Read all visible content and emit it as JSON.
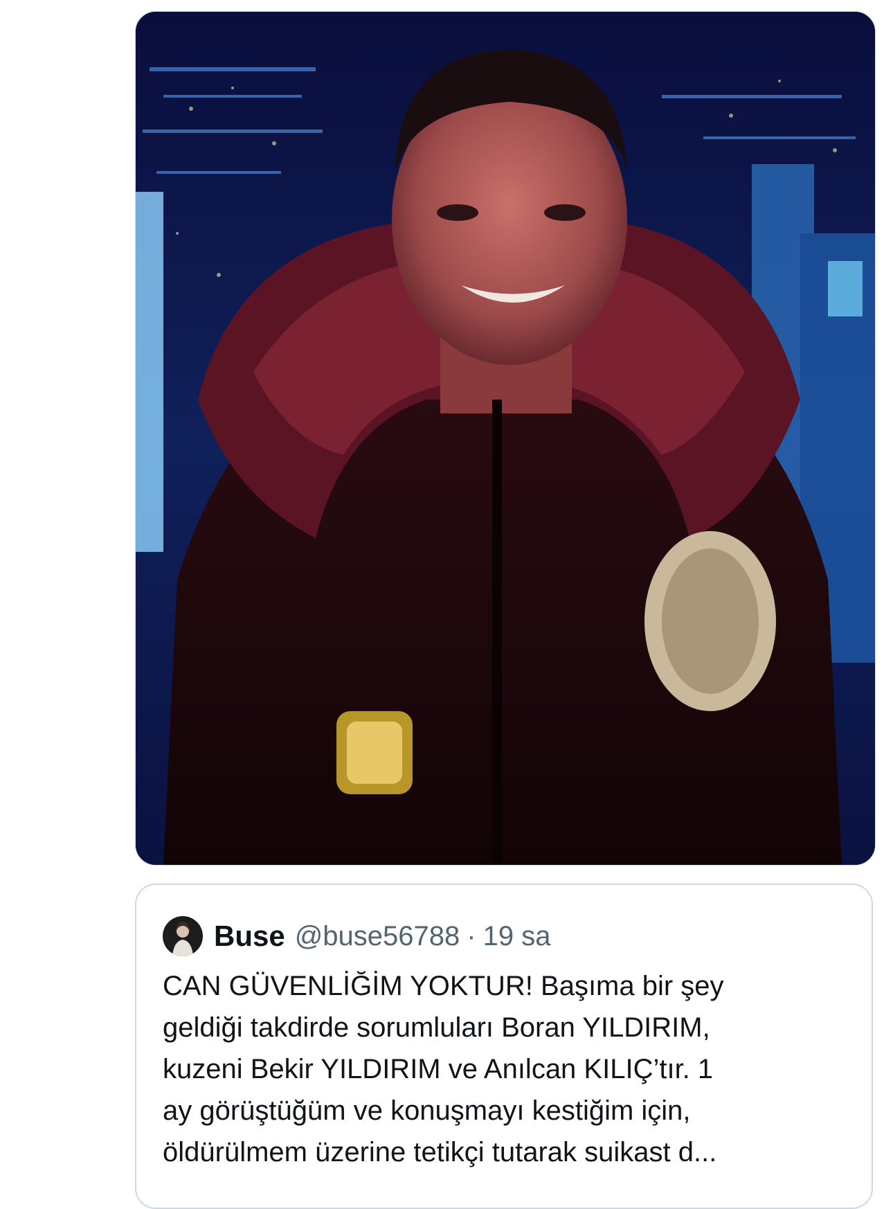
{
  "quoted_tweet": {
    "display_name": "Buse",
    "handle": "@buse56788",
    "separator": "·",
    "timestamp": "19 sa",
    "text_lines": [
      "CAN GÜVENLİĞİM YOKTUR! Başıma bir şey",
      "geldiği takdirde sorumluları Boran YILDIRIM,",
      "kuzeni Bekir YILDIRIM ve Anılcan KILIÇ’tır. 1",
      "ay görüştüğüm ve konuşmayı kestiğim için,",
      "öldürülmem üzerine tetikçi tutarak suikast d..."
    ]
  },
  "colors": {
    "text_primary": "#0f1419",
    "text_secondary": "#536471",
    "border": "#cfd9de",
    "background": "#ffffff"
  }
}
